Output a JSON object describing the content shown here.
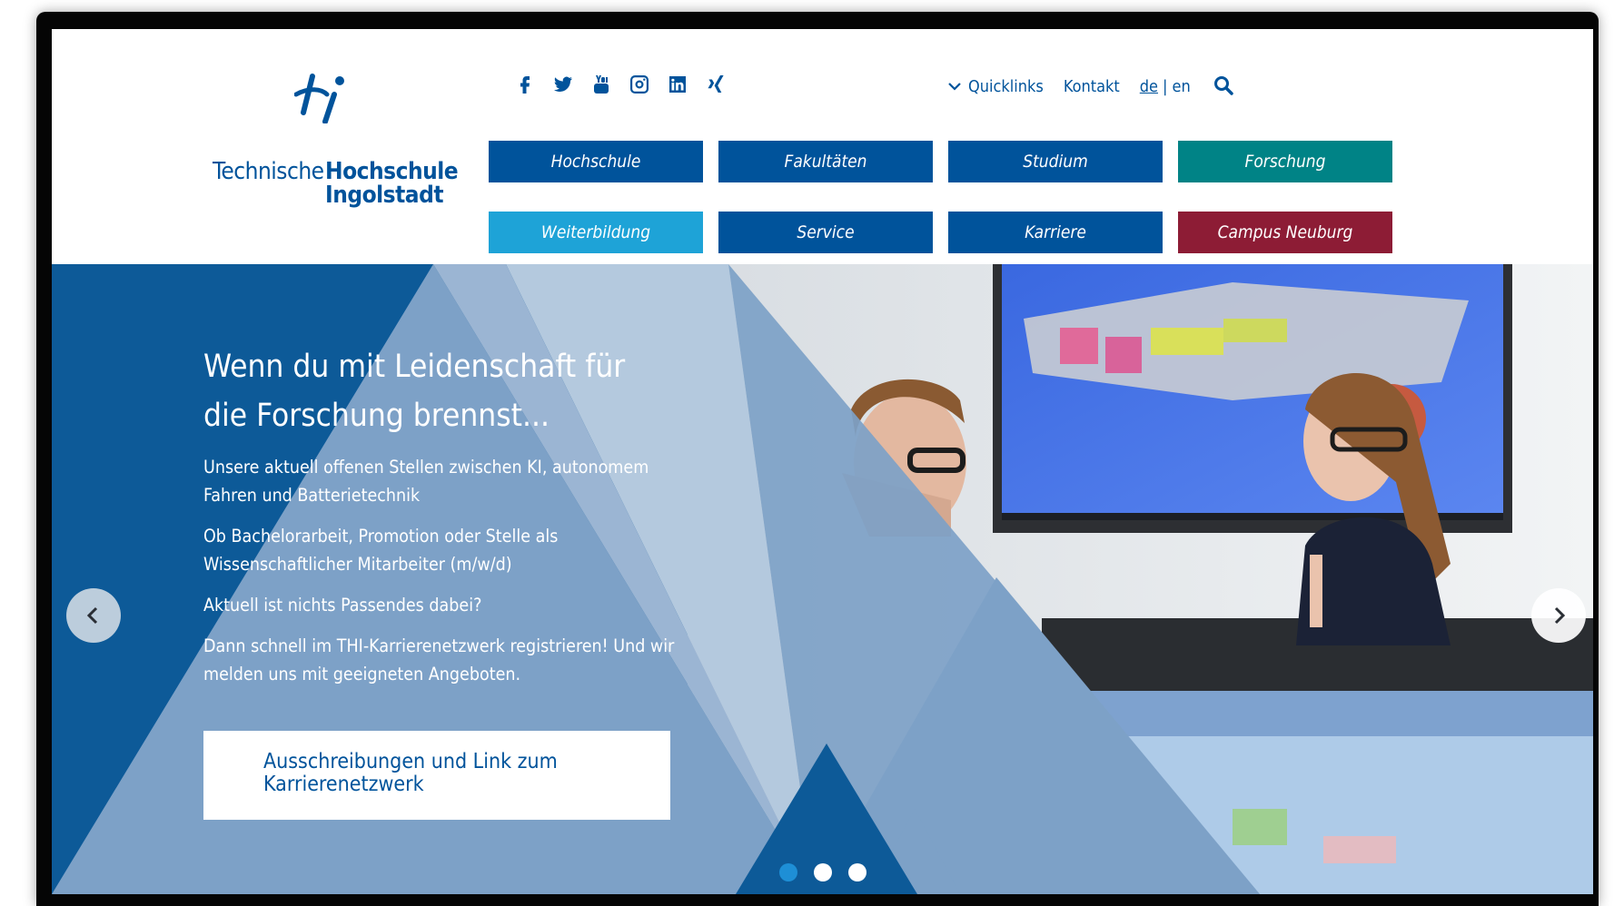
{
  "logo": {
    "word1": "Technische",
    "word2": "Hochschule",
    "word3": "Ingolstadt"
  },
  "social": [
    {
      "icon": "facebook-icon"
    },
    {
      "icon": "twitter-icon"
    },
    {
      "icon": "youtube-icon"
    },
    {
      "icon": "instagram-icon"
    },
    {
      "icon": "linkedin-icon"
    },
    {
      "icon": "xing-icon"
    }
  ],
  "meta_nav": {
    "quicklinks": "Quicklinks",
    "kontakt": "Kontakt",
    "lang_de": "de",
    "lang_sep": "|",
    "lang_en": "en"
  },
  "main_nav": [
    {
      "label": "Hochschule",
      "color": "#00539b"
    },
    {
      "label": "Fakultäten",
      "color": "#00539b"
    },
    {
      "label": "Studium",
      "color": "#00539b"
    },
    {
      "label": "Forschung",
      "color": "#008386"
    },
    {
      "label": "Weiterbildung",
      "color": "#1ea3d7"
    },
    {
      "label": "Service",
      "color": "#00539b"
    },
    {
      "label": "Karriere",
      "color": "#00539b"
    },
    {
      "label": "Campus Neuburg",
      "color": "#8d1c35"
    }
  ],
  "hero": {
    "headline": "Wenn du mit Leidenschaft für die Forschung brennst...",
    "paragraphs": [
      "Unsere aktuell offenen Stellen zwischen KI, autonomem Fahren und Batterietechnik",
      "Ob Bachelorarbeit, Promotion oder Stelle als Wissenschaftlicher Mitarbeiter (m/w/d)",
      "Aktuell ist nichts Passendes dabei?",
      "Dann schnell im THI-Karrierenetzwerk registrieren! Und wir melden uns mit geeigneten Angeboten."
    ],
    "cta": "Ausschreibungen und Link zum Karrierenetzwerk",
    "slides_total": 3,
    "active_slide": 1
  },
  "colors": {
    "brand_blue": "#00539b",
    "teal": "#008386",
    "light_blue": "#1ea3d7",
    "bordeaux": "#8d1c35",
    "dot_active": "#1e8fd6"
  }
}
